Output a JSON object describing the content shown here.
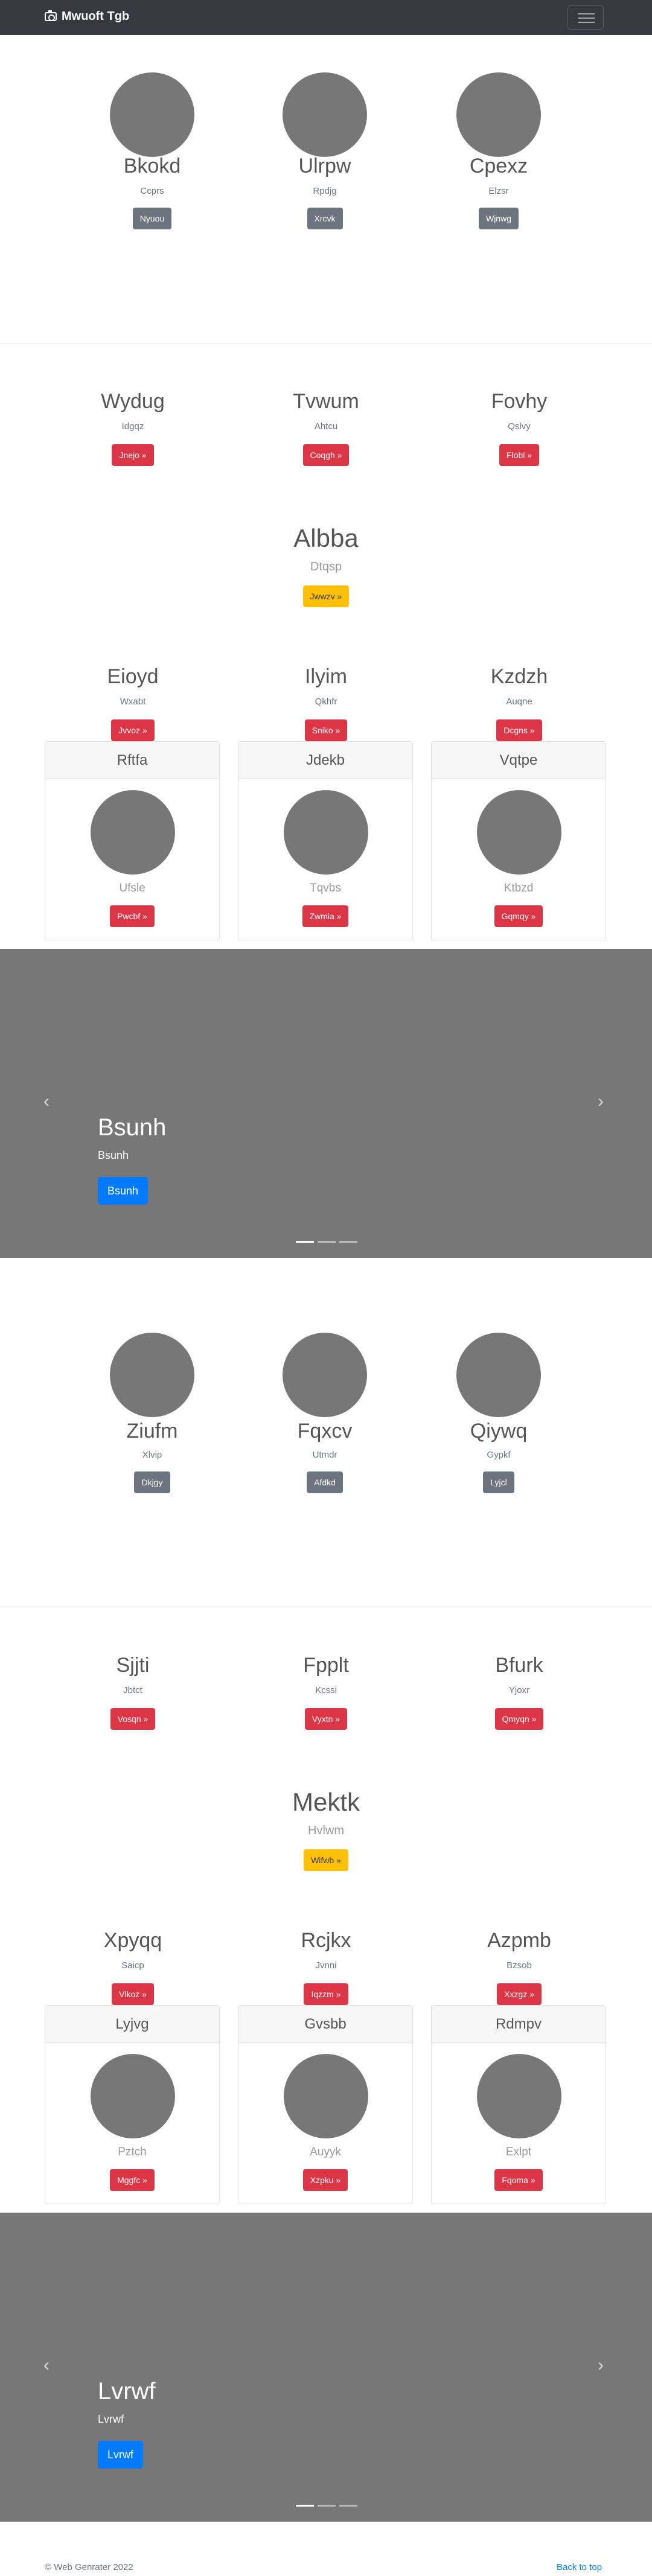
{
  "navbar": {
    "brand": "Mwuoft Tgb",
    "brand_icon": "camera-icon",
    "toggler_icon": "hamburger-icon"
  },
  "sec1": [
    {
      "name": "Bkokd",
      "sub": "Ccprs",
      "btn": "Nyuou"
    },
    {
      "name": "Ulrpw",
      "sub": "Rpdjg",
      "btn": "Xrcvk"
    },
    {
      "name": "Cpexz",
      "sub": "Elzsr",
      "btn": "Wjnwg"
    }
  ],
  "sec2": [
    {
      "name": "Wydug",
      "sub": "Idgqz",
      "btn": "Jnejo »"
    },
    {
      "name": "Tvwum",
      "sub": "Ahtcu",
      "btn": "Coqgh »"
    },
    {
      "name": "Fovhy",
      "sub": "Qslvy",
      "btn": "Flobl »"
    }
  ],
  "sec2_feature": {
    "name": "Albba",
    "sub": "Dtqsp",
    "btn": "Jwwzv »"
  },
  "sec2_row2": [
    {
      "name": "Eioyd",
      "sub": "Wxabt",
      "btn": "Jvvoz »"
    },
    {
      "name": "Ilyim",
      "sub": "Qkhfr",
      "btn": "Sniko »"
    },
    {
      "name": "Kzdzh",
      "sub": "Auqne",
      "btn": "Dcgns »"
    }
  ],
  "cards1": [
    {
      "title": "Rftfa",
      "label": "Ufsle",
      "btn": "Pwcbf »"
    },
    {
      "title": "Jdekb",
      "label": "Tqvbs",
      "btn": "Zwmia »"
    },
    {
      "title": "Vqtpe",
      "label": "Ktbzd",
      "btn": "Gqmqy »"
    }
  ],
  "carousel1": {
    "title": "Bsunh",
    "sub": "Bsunh",
    "btn": "Bsunh",
    "prev": "‹",
    "next": "›"
  },
  "sec3": [
    {
      "name": "Ziufm",
      "sub": "Xlvip",
      "btn": "Dkjgy"
    },
    {
      "name": "Fqxcv",
      "sub": "Utmdr",
      "btn": "Afdkd"
    },
    {
      "name": "Qiywq",
      "sub": "Gypkf",
      "btn": "Lyjcl"
    }
  ],
  "sec4": [
    {
      "name": "Sjjti",
      "sub": "Jbtct",
      "btn": "Vosqn »"
    },
    {
      "name": "Fpplt",
      "sub": "Kcssi",
      "btn": "Vyxtn »"
    },
    {
      "name": "Bfurk",
      "sub": "Yjoxr",
      "btn": "Qmyqn »"
    }
  ],
  "sec4_feature": {
    "name": "Mektk",
    "sub": "Hvlwm",
    "btn": "Wifwb »"
  },
  "sec4_row2": [
    {
      "name": "Xpyqq",
      "sub": "Saicp",
      "btn": "Vlkoz »"
    },
    {
      "name": "Rcjkx",
      "sub": "Jvnni",
      "btn": "Iqzzm »"
    },
    {
      "name": "Azpmb",
      "sub": "Bzsob",
      "btn": "Xxzgz »"
    }
  ],
  "cards2": [
    {
      "title": "Lyjvg",
      "label": "Pztch",
      "btn": "Mggfc »"
    },
    {
      "title": "Gvsbb",
      "label": "Auyyk",
      "btn": "Xzpku »"
    },
    {
      "title": "Rdmpv",
      "label": "Exlpt",
      "btn": "Fqoma »"
    }
  ],
  "carousel2": {
    "title": "Lvrwf",
    "sub": "Lvrwf",
    "btn": "Lvrwf",
    "prev": "‹",
    "next": "›"
  },
  "footer": {
    "copyright": "© Web Genrater 2022",
    "back_to_top": "Back to top"
  }
}
